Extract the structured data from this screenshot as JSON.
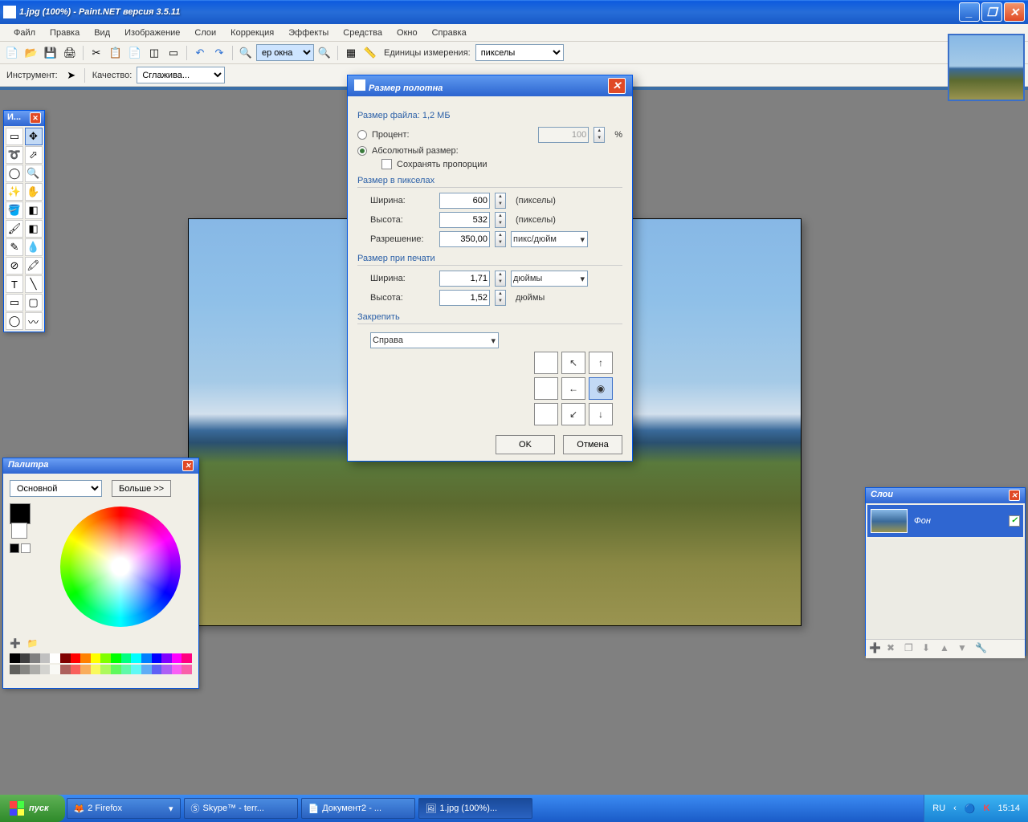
{
  "title": "1.jpg (100%) - Paint.NET версия 3.5.11",
  "menu": [
    "Файл",
    "Правка",
    "Вид",
    "Изображение",
    "Слои",
    "Коррекция",
    "Эффекты",
    "Средства",
    "Окно",
    "Справка"
  ],
  "toolbar1": {
    "zoom_combo": "ер окна",
    "units_label": "Единицы измерения:",
    "units_value": "пикселы"
  },
  "toolbar2": {
    "instrument_label": "Инструмент:",
    "quality_label": "Качество:",
    "quality_value": "Сглажива..."
  },
  "tools_panel_title": "И...",
  "color_panel": {
    "title": "Палитра",
    "type_select": "Основной",
    "more_btn": "Больше >>",
    "strip_colors": [
      "#000",
      "#404040",
      "#808080",
      "#c0c0c0",
      "#fff",
      "#800000",
      "#f00",
      "#ff8000",
      "#ff0",
      "#80ff00",
      "#0f0",
      "#00ff80",
      "#0ff",
      "#0080ff",
      "#00f",
      "#8000ff",
      "#f0f",
      "#ff0080"
    ]
  },
  "layers_panel": {
    "title": "Слои",
    "layer0": "Фон"
  },
  "dialog": {
    "title": "Размер полотна",
    "file_size": "Размер файла: 1,2 МБ",
    "percent_label": "Процент:",
    "percent_value": "100",
    "percent_unit": "%",
    "absolute_label": "Абсолютный размер:",
    "keep_aspect": "Сохранять пропорции",
    "pixel_size_title": "Размер в пикселах",
    "width_label": "Ширина:",
    "height_label": "Высота:",
    "width_px": "600",
    "height_px": "532",
    "px_unit": "(пикселы)",
    "resolution_label": "Разрешение:",
    "resolution_value": "350,00",
    "resolution_unit": "пикс/дюйм",
    "print_size_title": "Размер при печати",
    "width_print": "1,71",
    "height_print": "1,52",
    "print_unit": "дюймы",
    "anchor_title": "Закрепить",
    "anchor_select": "Справа",
    "ok": "OK",
    "cancel": "Отмена"
  },
  "taskbar": {
    "start": "пуск",
    "items": [
      "2 Firefox",
      "Skype™ - terr...",
      "Документ2 - ...",
      "1.jpg (100%)..."
    ],
    "lang": "RU",
    "time": "15:14"
  }
}
